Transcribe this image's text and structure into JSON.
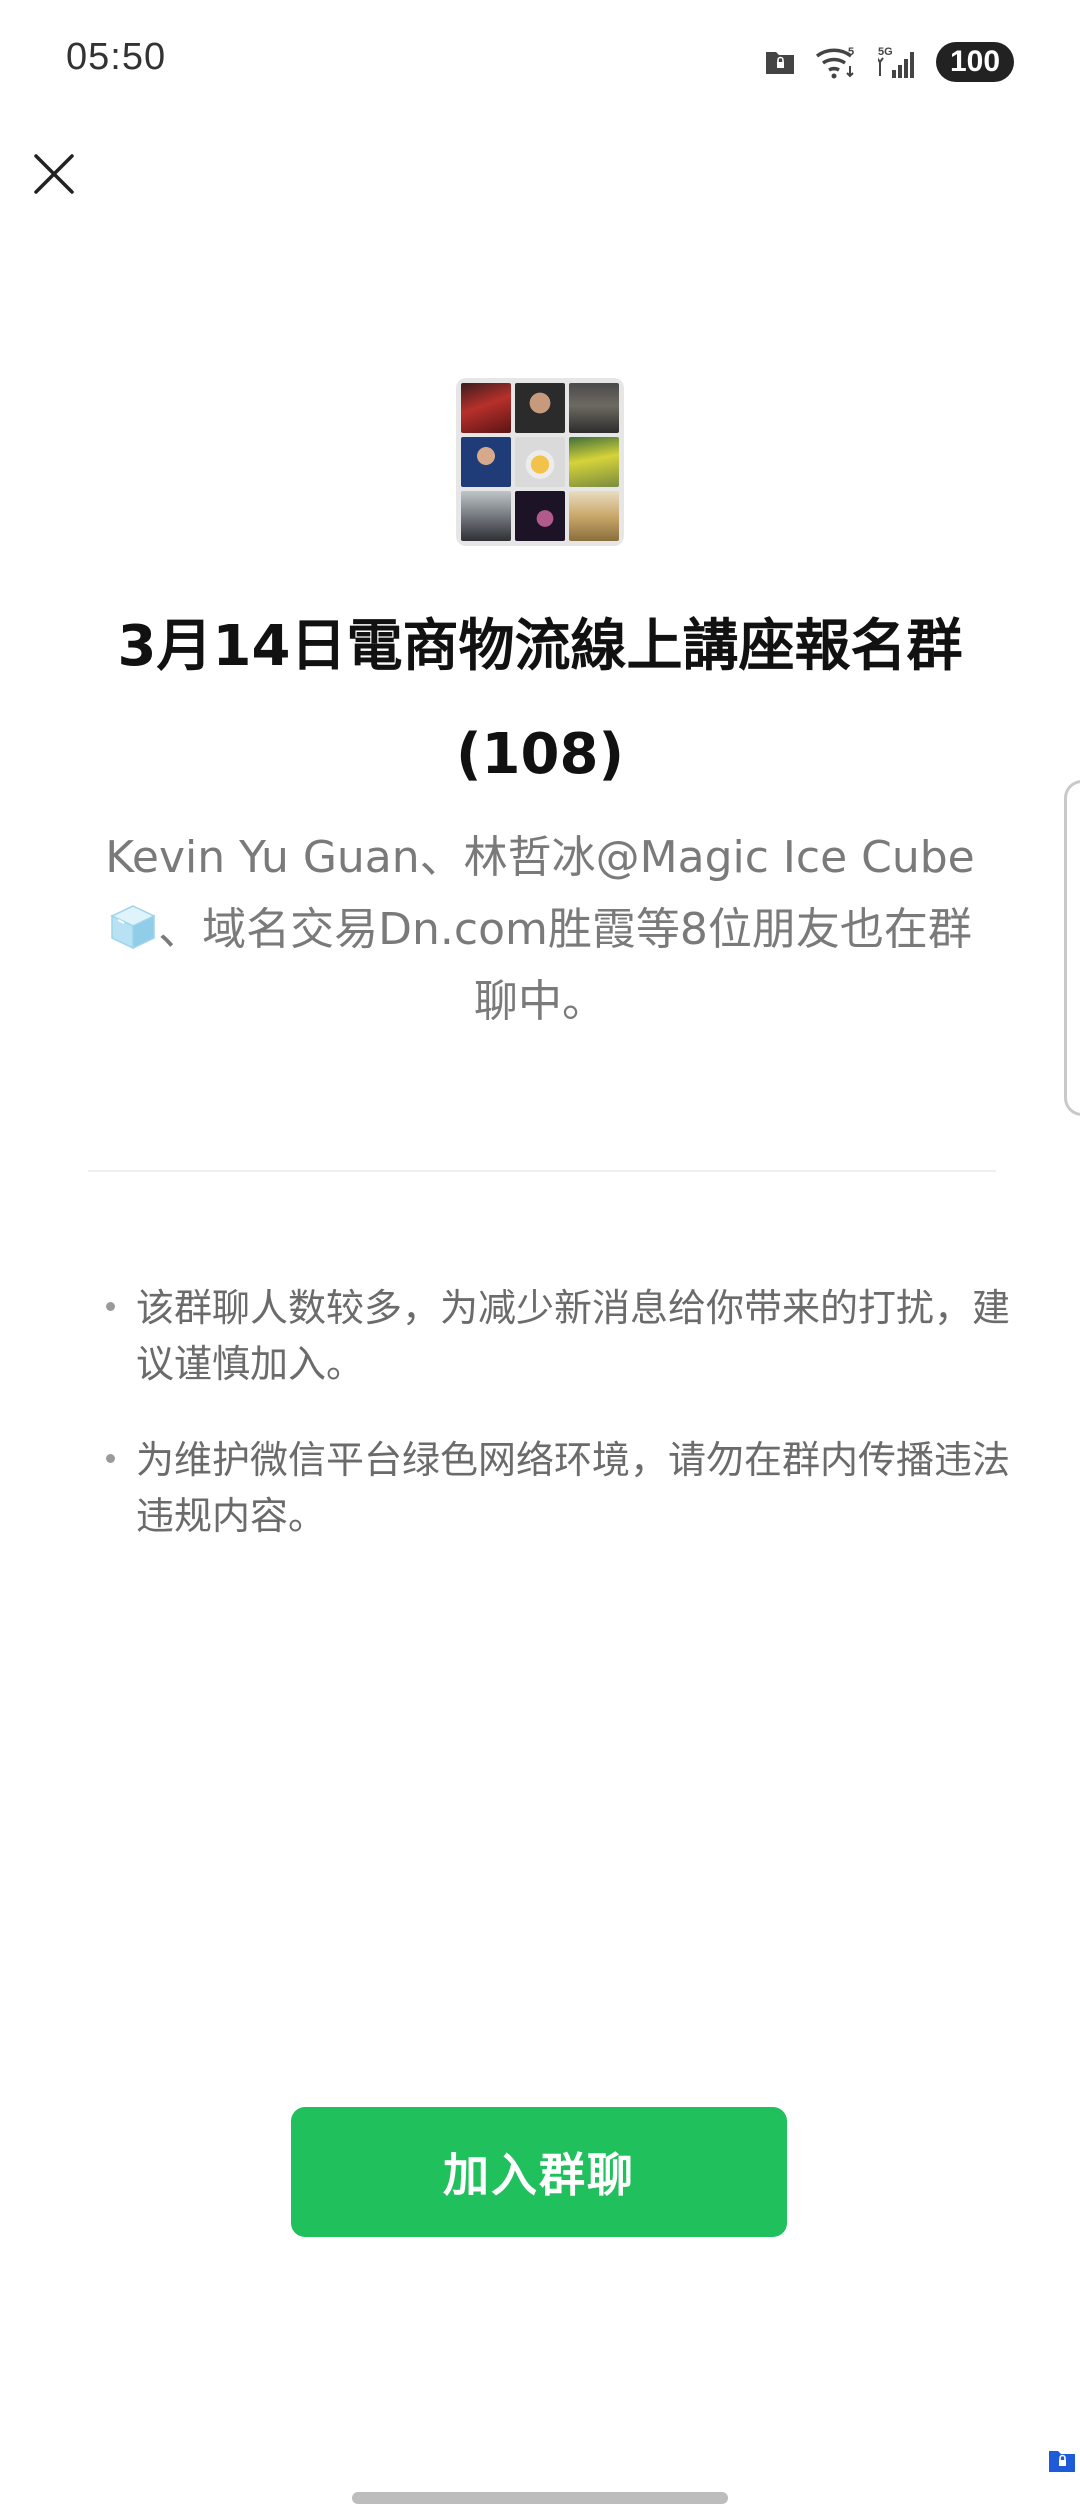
{
  "status_bar": {
    "time": "05:50",
    "network_wifi_badge": "5",
    "network_cell_badge": "5G",
    "battery": "100"
  },
  "group": {
    "title": "3月14日電商物流線上講座報名群",
    "member_count": "(108)",
    "friends_part1": "Kevin Yu Guan、林哲冰@Magic Ice Cube",
    "friends_part2": "、域名交易Dn.com胜霞等8位朋友也在群聊中。"
  },
  "notices": [
    "该群聊人数较多，为减少新消息给你带来的打扰，建议谨慎加入。",
    "为维护微信平台绿色网络环境，请勿在群内传播违法违规内容。"
  ],
  "join_button": {
    "label": "加入群聊"
  },
  "icons": {
    "close": "close-icon",
    "ice_cube": "ice-cube-emoji-icon",
    "folder": "folder-lock-icon",
    "wifi": "wifi-icon",
    "signal": "signal-icon"
  },
  "colors": {
    "primary_button": "#20c05c",
    "title_text": "#111111",
    "secondary_text": "#7a7a7a"
  }
}
